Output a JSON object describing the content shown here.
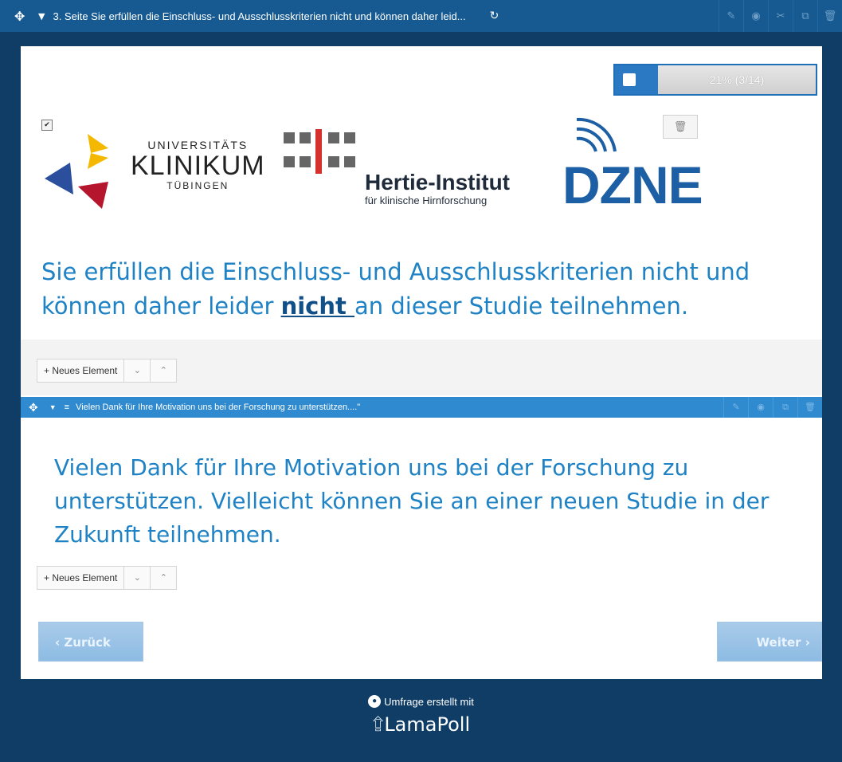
{
  "topbar": {
    "title": "3. Seite Sie erfüllen die Einschluss- und Ausschlusskriterien nicht und können daher leid...",
    "icons": [
      "move-icon",
      "chevron-down-icon",
      "spinner-icon",
      "edit-icon",
      "eye-icon",
      "cut-icon",
      "copy-icon",
      "trash-icon"
    ]
  },
  "progress": {
    "label": "21% (3/14)",
    "fraction": 0.21
  },
  "logos": {
    "ukt": {
      "line1": "UNIVERSITÄTS",
      "line2": "KLINIKUM",
      "line3": "TÜBINGEN"
    },
    "hertie": {
      "line1": "Hertie-Institut",
      "line2": "für klinische Hirnforschung"
    },
    "dzne": {
      "word": "DZNE"
    }
  },
  "main": {
    "text_before": "Sie erfüllen die Einschluss- und Ausschlusskriterien nicht und können daher leider ",
    "emphasis": "nicht ",
    "text_after": "an dieser Studie teilnehmen."
  },
  "new_element": {
    "label": "+ Neues Element",
    "down": "⌄",
    "up": "⌃"
  },
  "subbar": {
    "title": "Vielen Dank für Ihre Motivation uns bei der Forschung zu unterstützen....\""
  },
  "second": {
    "text": "Vielen Dank für Ihre Motivation uns bei der Forschung zu unterstützen. Vielleicht können Sie an einer neuen Studie in der Zukunft teilnehmen."
  },
  "nav": {
    "back": "‹ Zurück",
    "next": "Weiter ›"
  },
  "footer": {
    "made_with": "Umfrage erstellt mit",
    "brand": "LamaPoll"
  },
  "colors": {
    "accent": "#1e82c4",
    "bar": "#165a91",
    "background": "#0f3d66"
  }
}
